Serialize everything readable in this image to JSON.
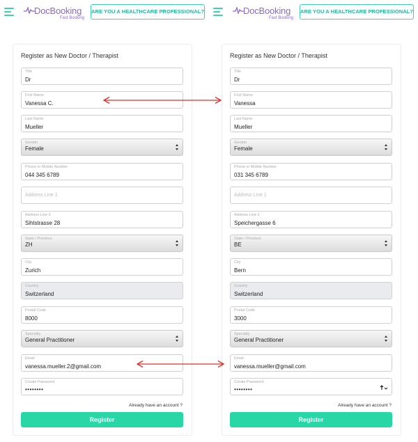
{
  "panels": [
    {
      "logo_text": "DocBooking",
      "logo_sub": "Fast Booking",
      "pro_button": "ARE YOU A HEALTHCARE PROFESSIONAL?",
      "form_title": "Register as New Doctor / Therapist",
      "fields": {
        "title": {
          "label": "Title",
          "value": "Dr"
        },
        "first_name": {
          "label": "First Name",
          "value": "Vanessa C."
        },
        "last_name": {
          "label": "Last Name",
          "value": "Mueller"
        },
        "gender": {
          "label": "Gender",
          "value": "Female"
        },
        "phone": {
          "label": "Phone or Mobile Number",
          "value": "044 345 6789"
        },
        "address1": {
          "placeholder": "Address Line 1"
        },
        "address2": {
          "label": "Address Line 2",
          "value": "Sihlstrasse 28"
        },
        "state": {
          "label": "State / Province",
          "value": "ZH"
        },
        "city": {
          "label": "City",
          "value": "Zurich"
        },
        "country": {
          "label": "Country",
          "value": "Switzerland"
        },
        "postal": {
          "label": "Postal Code",
          "value": "8000"
        },
        "specialty": {
          "label": "Specialty",
          "value": "General Practitioner"
        },
        "email": {
          "label": "Email",
          "value": "vanessa.mueller.2@gmail.com"
        },
        "password": {
          "label": "Create Password",
          "value": "••••••••"
        }
      },
      "account_link": "Already have an account ?",
      "register_button": "Register"
    },
    {
      "logo_text": "DocBooking",
      "logo_sub": "Fast Booking",
      "pro_button": "ARE YOU A HEALTHCARE PROFESSIONAL?",
      "form_title": "Register as New Doctor / Therapist",
      "fields": {
        "title": {
          "label": "Title",
          "value": "Dr"
        },
        "first_name": {
          "label": "First Name",
          "value": "Vanessa"
        },
        "last_name": {
          "label": "Last Name",
          "value": "Mueller"
        },
        "gender": {
          "label": "Gender",
          "value": "Female"
        },
        "phone": {
          "label": "Phone or Mobile Number",
          "value": "031 345 6789"
        },
        "address1": {
          "placeholder": "Address Line 1"
        },
        "address2": {
          "label": "Address Line 2",
          "value": "Speichergasse 6"
        },
        "state": {
          "label": "State / Province",
          "value": "BE"
        },
        "city": {
          "label": "City",
          "value": "Bern"
        },
        "country": {
          "label": "Country",
          "value": "Switzerland"
        },
        "postal": {
          "label": "Postal Code",
          "value": "3000"
        },
        "specialty": {
          "label": "Specialty",
          "value": "General Practitioner"
        },
        "email": {
          "label": "Email",
          "value": "vanessa.mueller@gmail.com"
        },
        "password": {
          "label": "Create Password",
          "value": "••••••••"
        }
      },
      "account_link": "Already have an account ?",
      "register_button": "Register"
    }
  ],
  "colors": {
    "accent": "#3ccfb5",
    "register": "#28d6a6",
    "logo": "#8b6ac7",
    "annotation_arrow": "#d9302b"
  },
  "icons": {
    "menu": "hamburger-icon",
    "logo_pulse": "heartbeat-icon",
    "password_toggle": "eye-toggle-icon",
    "annotation": "double-arrow"
  }
}
